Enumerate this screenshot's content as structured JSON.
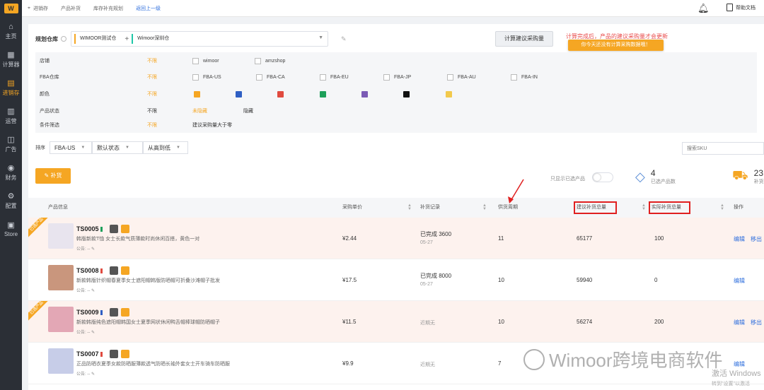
{
  "sidebar": {
    "logo": "W",
    "items": [
      {
        "label": "主页",
        "icon": "home-icon",
        "glyph": "⌂"
      },
      {
        "label": "计算器",
        "icon": "calculator-icon",
        "glyph": "▦"
      },
      {
        "label": "进销存",
        "icon": "inventory-icon",
        "glyph": "▤",
        "active": true
      },
      {
        "label": "运营",
        "icon": "operations-icon",
        "glyph": "▥"
      },
      {
        "label": "广告",
        "icon": "ads-icon",
        "glyph": "◫"
      },
      {
        "label": "财务",
        "icon": "finance-icon",
        "glyph": "◉"
      },
      {
        "label": "配置",
        "icon": "settings-icon",
        "glyph": "⚙"
      },
      {
        "label": "Store",
        "icon": "store-icon",
        "glyph": "▣"
      }
    ]
  },
  "topbar": {
    "breadcrumb": [
      "进销存",
      "产品补货",
      "库存补充规划"
    ],
    "back_label": "返回上一级",
    "help_label": "帮助文档"
  },
  "warehouse": {
    "label": "规划仓库",
    "tags": [
      "WIMOOR测试仓",
      "Wimoor深圳仓"
    ]
  },
  "calc_button": "计算建议采购量",
  "calc_note": "计算完成后，产品的建议采购量才会更新",
  "tooltip": "你今天还没有计算采购数据哦！",
  "filters": {
    "shop_label": "店铺",
    "fba_label": "FBA仓库",
    "color_label": "颜色",
    "status_label": "产品状态",
    "condition_label": "条件筛选",
    "all": "不限",
    "shops": [
      "wimoor",
      "amzshop"
    ],
    "fba": [
      "FBA-US",
      "FBA-CA",
      "FBA-EU",
      "FBA-JP",
      "FBA-AU",
      "FBA-IN"
    ],
    "colors": [
      "#f5a623",
      "#2f5fc4",
      "#e04a3f",
      "#1ea05a",
      "#7b5bb5",
      "#111111",
      "#f2c94c"
    ],
    "status_options": [
      "未隐藏",
      "隐藏"
    ],
    "condition_option": "建议采购量大于零"
  },
  "sort": {
    "label": "排序",
    "market": "FBA-US",
    "state": "默认状态",
    "order": "从高到低",
    "search_placeholder": "搜索SKU"
  },
  "replenish_button": "补货",
  "toggle_label": "只显示已选产品",
  "stats": {
    "selected_count": "4",
    "selected_label": "已选产品数",
    "replenish_count": "23",
    "replenish_label": "补货"
  },
  "table": {
    "headers": {
      "product": "产品信息",
      "price": "采购单价",
      "record": "补货记录",
      "cycle": "供货周期",
      "suggested": "建议补货总量",
      "actual": "实际补货总量",
      "action": "操作"
    },
    "rows": [
      {
        "selected": true,
        "ribbon": "已选产品",
        "sku": "TS0005",
        "flag": "#1ea05a",
        "title": "韩版新款T恤 女士长款气质薄款时尚休闲百搭，黄色一对",
        "note": "公告: --",
        "price": "¥2.44",
        "record": "已完成 3600",
        "record_date": "05-27",
        "cycle": "11",
        "suggested": "65177",
        "actual": "100",
        "edit": "编辑",
        "remove": "移出",
        "thumb": "#e8e4ee"
      },
      {
        "selected": false,
        "ribbon": "",
        "sku": "TS0008",
        "flag": "#e04a3f",
        "title": "新款韩版针织帽春夏季女士遮阳帽韩版防晒帽可折叠沙滩帽子批发",
        "note": "公告: --",
        "price": "¥17.5",
        "record": "已完成 8000",
        "record_date": "05-27",
        "cycle": "10",
        "suggested": "59940",
        "actual": "0",
        "edit": "编辑",
        "remove": "",
        "thumb": "#c9967d"
      },
      {
        "selected": true,
        "ribbon": "已选产品",
        "sku": "TS0009",
        "flag": "#2f5fc4",
        "title": "新款韩版纯色遮阳帽韩国女士夏季网状休闲鸭舌帽棒球帽防晒帽子",
        "note": "公告: --",
        "price": "¥11.5",
        "record": "近期无",
        "record_date": "",
        "cycle": "10",
        "suggested": "56274",
        "actual": "200",
        "edit": "编辑",
        "remove": "移出",
        "thumb": "#e3a7b5"
      },
      {
        "selected": false,
        "ribbon": "",
        "sku": "TS0007",
        "flag": "#e04a3f",
        "title": "正品防晒衣夏季女款防晒服薄款透气防晒长袖外套女士开车骑车防晒服",
        "note": "公告: --",
        "price": "¥9.9",
        "record": "近期无",
        "record_date": "",
        "cycle": "7",
        "suggested": "",
        "actual": "",
        "edit": "编辑",
        "remove": "",
        "thumb": "#c7cde8"
      }
    ]
  },
  "watermark": "Wimoor跨境电商软件",
  "activate": "激活 Windows",
  "activate_sub": "转到\"设置\"以激活"
}
